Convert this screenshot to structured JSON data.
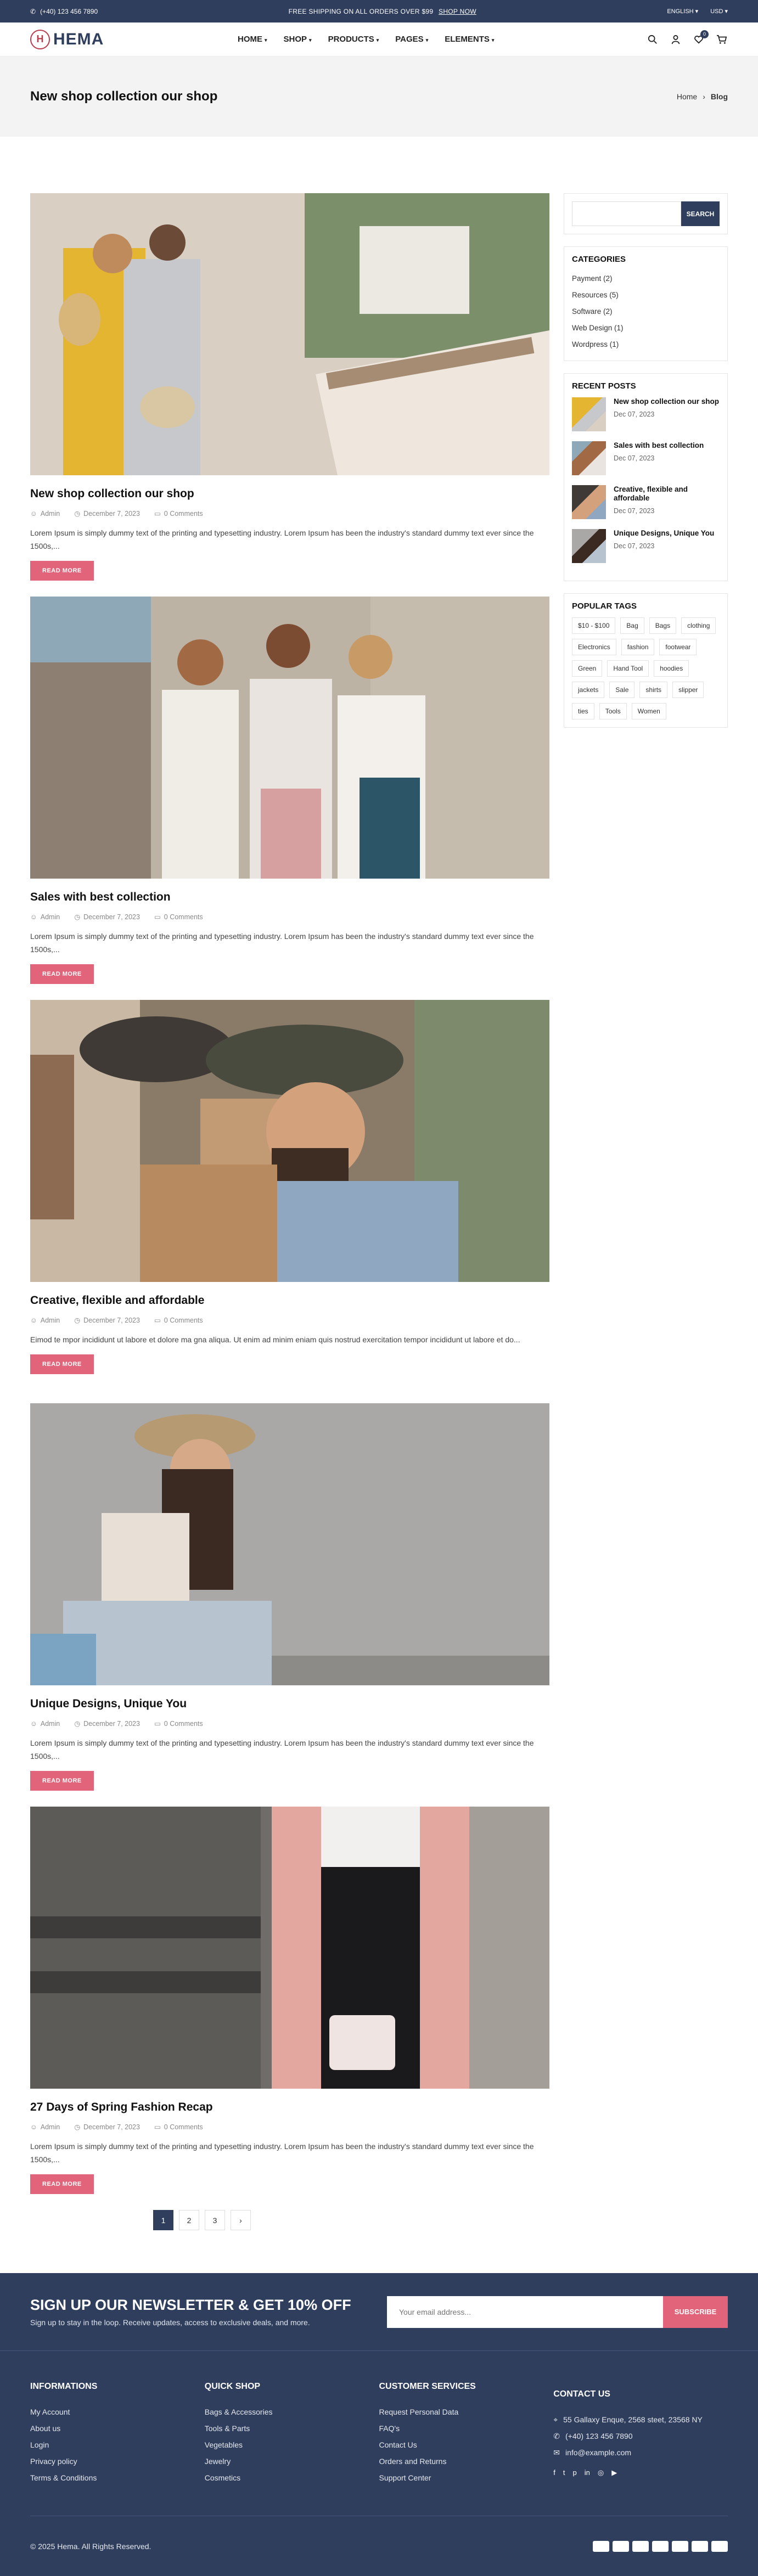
{
  "topbar": {
    "phone": "(+40) 123 456 7890",
    "promo": "FREE SHIPPING ON ALL ORDERS OVER $99",
    "promo_link": "SHOP NOW",
    "language": "ENGLISH",
    "currency": "USD"
  },
  "header": {
    "logo": "HEMA",
    "nav": [
      "HOME",
      "SHOP",
      "PRODUCTS",
      "PAGES",
      "ELEMENTS"
    ],
    "cart_count": "0"
  },
  "pagehead": {
    "title": "New shop collection our shop",
    "crumb_home": "Home",
    "crumb_current": "Blog"
  },
  "posts": [
    {
      "title": "New shop collection our shop",
      "author": "Admin",
      "date": "December 7, 2023",
      "comments": "0 Comments",
      "excerpt": "Lorem Ipsum is simply dummy text of the printing and typesetting industry. Lorem Ipsum has been the industry's standard dummy text ever since the 1500s,...",
      "readmore": "READ MORE"
    },
    {
      "title": "Sales with best collection",
      "author": "Admin",
      "date": "December 7, 2023",
      "comments": "0 Comments",
      "excerpt": "Lorem Ipsum is simply dummy text of the printing and typesetting industry. Lorem Ipsum has been the industry's standard dummy text ever since the 1500s,...",
      "readmore": "READ MORE"
    },
    {
      "title": "Creative, flexible and affordable",
      "author": "Admin",
      "date": "December 7, 2023",
      "comments": "0 Comments",
      "excerpt": "Eimod te mpor incididunt ut labore et dolore ma gna aliqua. Ut enim ad minim eniam quis nostrud exercitation tempor incididunt ut labore et do...",
      "readmore": "READ MORE"
    },
    {
      "title": "Unique Designs, Unique You",
      "author": "Admin",
      "date": "December 7, 2023",
      "comments": "0 Comments",
      "excerpt": "Lorem Ipsum is simply dummy text of the printing and typesetting industry. Lorem Ipsum has been the industry's standard dummy text ever since the 1500s,...",
      "readmore": "READ MORE"
    },
    {
      "title": "27 Days of Spring Fashion Recap",
      "author": "Admin",
      "date": "December 7, 2023",
      "comments": "0 Comments",
      "excerpt": "Lorem Ipsum is simply dummy text of the printing and typesetting industry. Lorem Ipsum has been the industry's standard dummy text ever since the 1500s,...",
      "readmore": "READ MORE"
    }
  ],
  "sidebar": {
    "search_button": "SEARCH",
    "categories_title": "CATEGORIES",
    "categories": [
      "Payment (2)",
      "Resources (5)",
      "Software (2)",
      "Web Design (1)",
      "Wordpress (1)"
    ],
    "recent_title": "RECENT POSTS",
    "recent": [
      {
        "title": "New shop collection our shop",
        "date": "Dec 07, 2023"
      },
      {
        "title": "Sales with best collection",
        "date": "Dec 07, 2023"
      },
      {
        "title": "Creative, flexible and affordable",
        "date": "Dec 07, 2023"
      },
      {
        "title": "Unique Designs, Unique You",
        "date": "Dec 07, 2023"
      }
    ],
    "tags_title": "POPULAR TAGS",
    "tags": [
      "$10 - $100",
      "Bag",
      "Bags",
      "clothing",
      "Electronics",
      "fashion",
      "footwear",
      "Green",
      "Hand Tool",
      "hoodies",
      "jackets",
      "Sale",
      "shirts",
      "slipper",
      "ties",
      "Tools",
      "Women"
    ]
  },
  "pagination": [
    "1",
    "2",
    "3",
    "›"
  ],
  "newsletter": {
    "title": "SIGN UP OUR NEWSLETTER & GET 10% OFF",
    "subtitle": "Sign up to stay in the loop. Receive updates, access to exclusive deals, and more.",
    "placeholder": "Your email address...",
    "button": "SUBSCRIBE"
  },
  "footer": {
    "col1": {
      "title": "INFORMATIONS",
      "items": [
        "My Account",
        "About us",
        "Login",
        "Privacy policy",
        "Terms & Conditions"
      ]
    },
    "col2": {
      "title": "QUICK SHOP",
      "items": [
        "Bags & Accessories",
        "Tools & Parts",
        "Vegetables",
        "Jewelry",
        "Cosmetics"
      ]
    },
    "col3": {
      "title": "CUSTOMER SERVICES",
      "items": [
        "Request Personal Data",
        "FAQ's",
        "Contact Us",
        "Orders and Returns",
        "Support Center"
      ]
    },
    "contact": {
      "title": "CONTACT US",
      "address": "55 Gallaxy Enque, 2568 steet, 23568 NY",
      "phone": "(+40) 123 456 7890",
      "email": "info@example.com"
    },
    "copyright": "© 2025 Hema. All Rights Reserved."
  }
}
